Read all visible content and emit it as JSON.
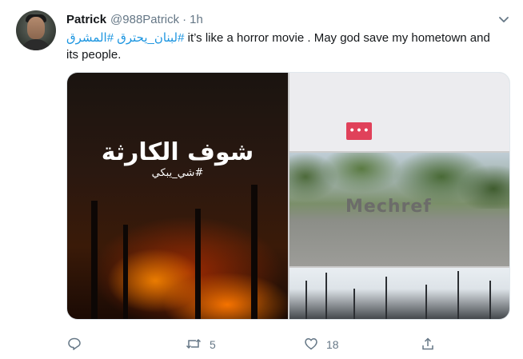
{
  "tweet": {
    "author_name": "Patrick",
    "handle": "@988Patrick",
    "separator": "·",
    "time": "1h",
    "text": {
      "hashtag_1": "#المشرق",
      "hashtag_2": "#لبنان_يحترق",
      "body": " it’s like a horror movie . May god save my hometown and its people."
    },
    "media": {
      "left_image_title": "شوف الكارثة",
      "left_image_subtitle": "#شي_يبكي",
      "top_right_badge": "• • •",
      "mid_right_sign": "Mechref"
    },
    "actions": {
      "reply_icon": "reply-icon",
      "retweet_icon": "retweet-icon",
      "retweet_count": "5",
      "like_icon": "heart-icon",
      "like_count": "18",
      "share_icon": "share-icon"
    }
  },
  "colors": {
    "hashtag": "#1b95e0",
    "secondary_text": "#657786",
    "primary_text": "#14171a"
  }
}
